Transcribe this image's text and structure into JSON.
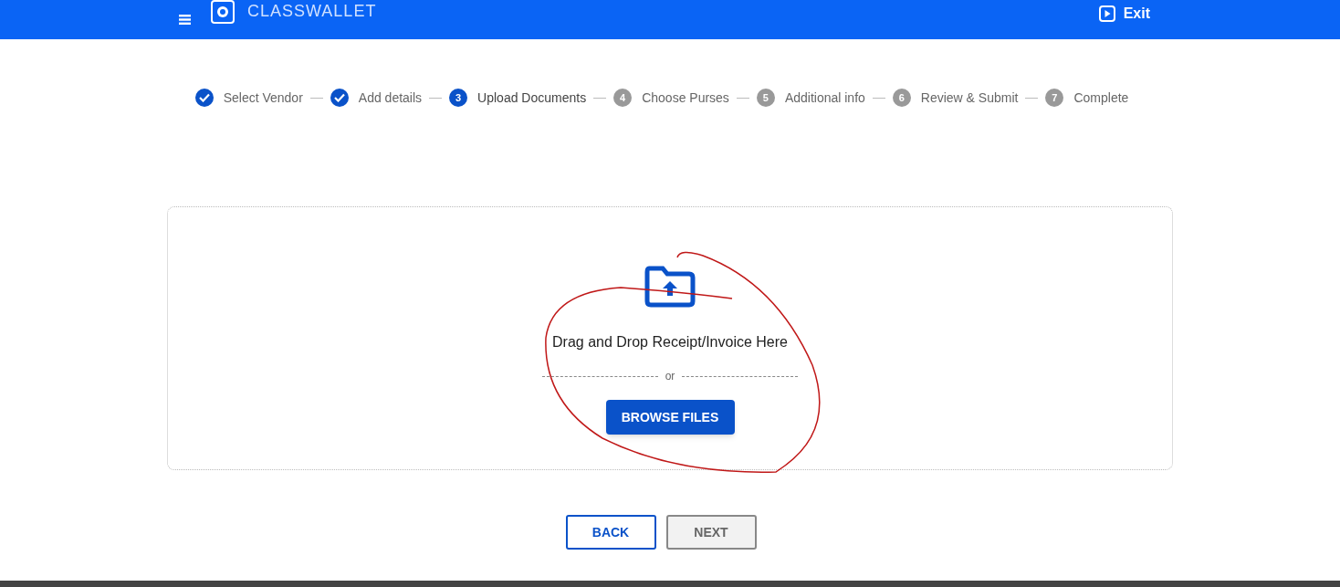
{
  "header": {
    "logo_text": "CLASSWALLET",
    "exit_label": "Exit"
  },
  "steps": [
    {
      "label": "Select Vendor",
      "completed": true,
      "selected": false
    },
    {
      "label": "Add details",
      "completed": true,
      "selected": false
    },
    {
      "number": "3",
      "label": "Upload Documents",
      "completed": false,
      "selected": true
    },
    {
      "number": "4",
      "label": "Choose Purses",
      "completed": false,
      "selected": false
    },
    {
      "number": "5",
      "label": "Additional info",
      "completed": false,
      "selected": false
    },
    {
      "number": "6",
      "label": "Review & Submit",
      "completed": false,
      "selected": false
    },
    {
      "number": "7",
      "label": "Complete",
      "completed": false,
      "selected": false
    }
  ],
  "dropzone": {
    "prompt": "Drag and Drop Receipt/Invoice Here",
    "separator": "or",
    "browse_button": "BROWSE FILES"
  },
  "buttons": [
    {
      "label": "BACK",
      "disabled": false
    },
    {
      "label": "NEXT",
      "disabled": true
    }
  ]
}
